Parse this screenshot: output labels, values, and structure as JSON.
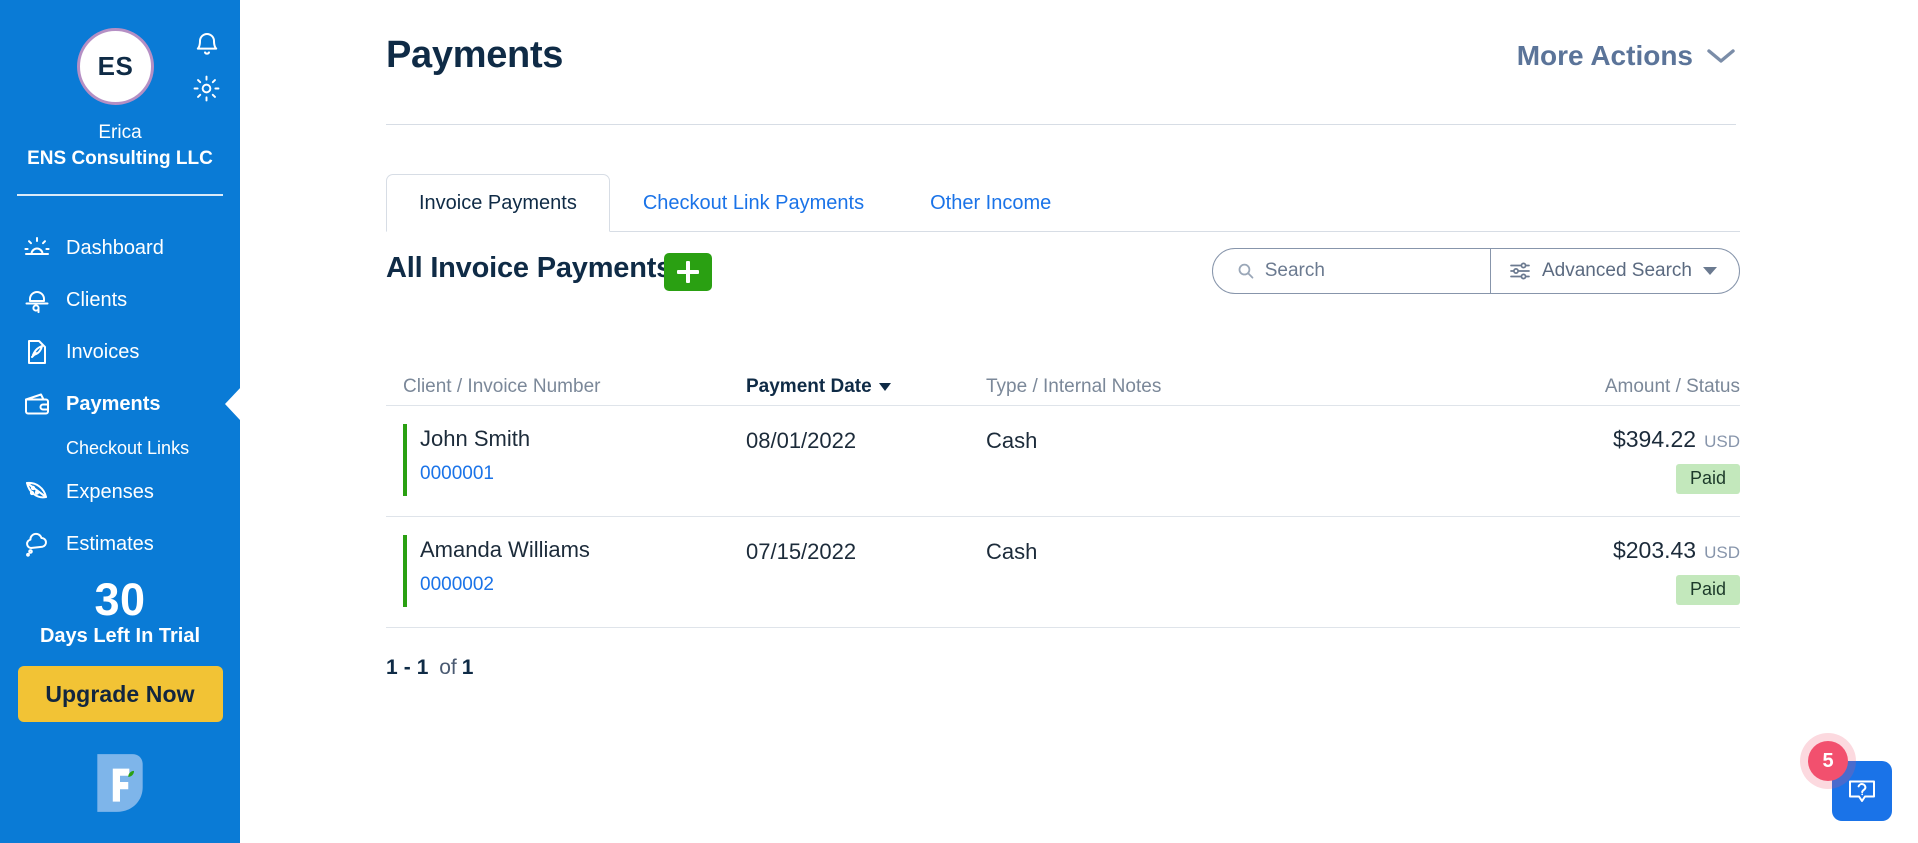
{
  "sidebar": {
    "avatar_initials": "ES",
    "user_name": "Erica",
    "org_name": "ENS Consulting LLC",
    "bell_icon": "bell-icon",
    "gear_icon": "gear-icon",
    "nav": [
      {
        "label": "Dashboard",
        "icon": "sunrise-icon",
        "active": false
      },
      {
        "label": "Clients",
        "icon": "bowler-hat-icon",
        "active": false
      },
      {
        "label": "Invoices",
        "icon": "quill-document-icon",
        "active": false
      },
      {
        "label": "Payments",
        "icon": "wallet-icon",
        "active": true
      },
      {
        "label": "Expenses",
        "icon": "pizza-slice-icon",
        "active": false
      },
      {
        "label": "Estimates",
        "icon": "cloud-thought-icon",
        "active": false
      }
    ],
    "sub_item": {
      "label": "Checkout Links"
    },
    "trial": {
      "days": "30",
      "label": "Days Left In Trial",
      "upgrade_label": "Upgrade Now"
    },
    "brand_logo": "freshbooks-logo"
  },
  "header": {
    "title": "Payments",
    "more_actions_label": "More Actions",
    "more_actions_icon": "chevron-down-icon"
  },
  "tabs": [
    {
      "label": "Invoice Payments",
      "active": true
    },
    {
      "label": "Checkout Link Payments",
      "active": false
    },
    {
      "label": "Other Income",
      "active": false
    }
  ],
  "list": {
    "title": "All Invoice Payments",
    "add_icon": "plus-icon",
    "search": {
      "placeholder": "Search",
      "value": "",
      "icon": "search-icon"
    },
    "advanced_search": {
      "label": "Advanced Search",
      "icon": "sliders-icon",
      "caret": "caret-down-icon"
    }
  },
  "table": {
    "columns": [
      {
        "label": "Client / Invoice Number",
        "sorted": false
      },
      {
        "label": "Payment Date",
        "sorted": true,
        "sort_dir": "desc"
      },
      {
        "label": "Type / Internal Notes",
        "sorted": false
      },
      {
        "label": "Amount / Status",
        "sorted": false
      }
    ],
    "rows": [
      {
        "client": "John Smith",
        "invoice_number": "0000001",
        "payment_date": "08/01/2022",
        "type": "Cash",
        "amount": "$394.22",
        "currency": "USD",
        "status": "Paid"
      },
      {
        "client": "Amanda Williams",
        "invoice_number": "0000002",
        "payment_date": "07/15/2022",
        "type": "Cash",
        "amount": "$203.43",
        "currency": "USD",
        "status": "Paid"
      }
    ]
  },
  "pagination": {
    "range_start": "1",
    "dash": "-",
    "range_end": "1",
    "of": "of",
    "total": "1"
  },
  "help_widget": {
    "badge_count": "5",
    "icon": "question-chat-icon"
  },
  "colors": {
    "sidebar_blue": "#0a7bd6",
    "link_blue": "#1a73e8",
    "accent_green": "#2aa012",
    "badge_green": "#c3e8bc",
    "upgrade_yellow": "#f2c335",
    "navy": "#0f2b46",
    "notification_red": "#f2506e"
  }
}
